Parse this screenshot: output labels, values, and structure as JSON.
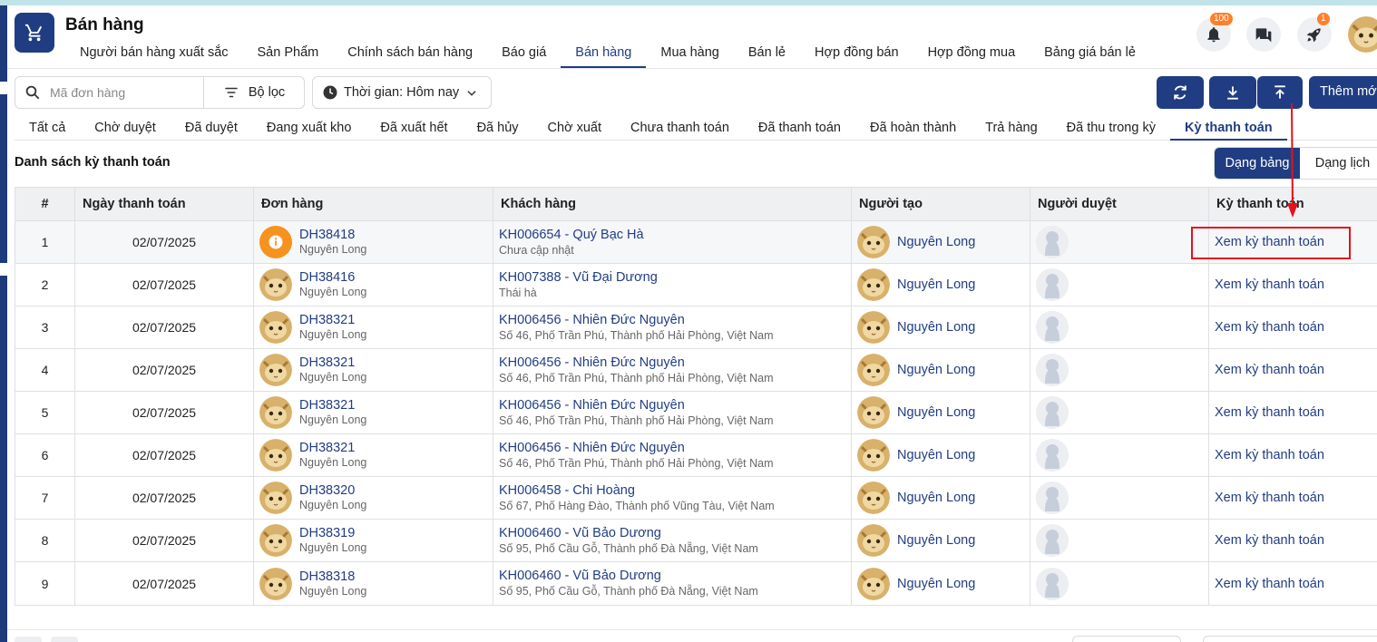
{
  "app": {
    "title": "Bán hàng"
  },
  "topnav": [
    {
      "label": "Người bán hàng xuất sắc",
      "active": false
    },
    {
      "label": "Sản Phẩm",
      "active": false
    },
    {
      "label": "Chính sách bán hàng",
      "active": false
    },
    {
      "label": "Báo giá",
      "active": false
    },
    {
      "label": "Bán hàng",
      "active": true
    },
    {
      "label": "Mua hàng",
      "active": false
    },
    {
      "label": "Bán lẻ",
      "active": false
    },
    {
      "label": "Hợp đồng bán",
      "active": false
    },
    {
      "label": "Hợp đồng mua",
      "active": false
    },
    {
      "label": "Bảng giá bán lẻ",
      "active": false
    }
  ],
  "header": {
    "notify_count": "100",
    "rocket_count": "1"
  },
  "toolbar": {
    "search_placeholder": "Mã đơn hàng",
    "filter_label": "Bộ lọc",
    "time_label": "Thời gian: Hôm nay",
    "add_label": "Thêm mới"
  },
  "status_tabs": [
    {
      "label": "Tất cả",
      "active": false
    },
    {
      "label": "Chờ duyệt",
      "active": false
    },
    {
      "label": "Đã duyệt",
      "active": false
    },
    {
      "label": "Đang xuất kho",
      "active": false
    },
    {
      "label": "Đã xuất hết",
      "active": false
    },
    {
      "label": "Đã hủy",
      "active": false
    },
    {
      "label": "Chờ xuất",
      "active": false
    },
    {
      "label": "Chưa thanh toán",
      "active": false
    },
    {
      "label": "Đã thanh toán",
      "active": false
    },
    {
      "label": "Đã hoàn thành",
      "active": false
    },
    {
      "label": "Trả hàng",
      "active": false
    },
    {
      "label": "Đã thu trong kỳ",
      "active": false
    },
    {
      "label": "Kỳ thanh toán",
      "active": true
    }
  ],
  "list": {
    "title": "Danh sách kỳ thanh toán",
    "view_table": "Dạng bảng",
    "view_calendar": "Dạng lịch"
  },
  "table": {
    "columns": [
      "#",
      "Ngày thanh toán",
      "Đơn hàng",
      "Khách hàng",
      "Người tạo",
      "Người duyệt",
      "Kỳ thanh toán"
    ],
    "rows": [
      {
        "no": "1",
        "date": "02/07/2025",
        "order": "DH38418",
        "order_by": "Nguyên Long",
        "customer": "KH006654 - Quý Bạc Hà",
        "address": "Chưa cập nhật",
        "creator": "Nguyên Long",
        "action": "Xem kỳ thanh toán",
        "info_icon": true
      },
      {
        "no": "2",
        "date": "02/07/2025",
        "order": "DH38416",
        "order_by": "Nguyên Long",
        "customer": "KH007388 - Vũ Đại Dương",
        "address": "Thái hà",
        "creator": "Nguyên Long",
        "action": "Xem kỳ thanh toán",
        "info_icon": false
      },
      {
        "no": "3",
        "date": "02/07/2025",
        "order": "DH38321",
        "order_by": "Nguyên Long",
        "customer": "KH006456 - Nhiên Đức Nguyên",
        "address": "Số 46, Phố Trần Phú, Thành phố Hải Phòng, Việt Nam",
        "creator": "Nguyên Long",
        "action": "Xem kỳ thanh toán",
        "info_icon": false
      },
      {
        "no": "4",
        "date": "02/07/2025",
        "order": "DH38321",
        "order_by": "Nguyên Long",
        "customer": "KH006456 - Nhiên Đức Nguyên",
        "address": "Số 46, Phố Trần Phú, Thành phố Hải Phòng, Việt Nam",
        "creator": "Nguyên Long",
        "action": "Xem kỳ thanh toán",
        "info_icon": false
      },
      {
        "no": "5",
        "date": "02/07/2025",
        "order": "DH38321",
        "order_by": "Nguyên Long",
        "customer": "KH006456 - Nhiên Đức Nguyên",
        "address": "Số 46, Phố Trần Phú, Thành phố Hải Phòng, Việt Nam",
        "creator": "Nguyên Long",
        "action": "Xem kỳ thanh toán",
        "info_icon": false
      },
      {
        "no": "6",
        "date": "02/07/2025",
        "order": "DH38321",
        "order_by": "Nguyên Long",
        "customer": "KH006456 - Nhiên Đức Nguyên",
        "address": "Số 46, Phố Trần Phú, Thành phố Hải Phòng, Việt Nam",
        "creator": "Nguyên Long",
        "action": "Xem kỳ thanh toán",
        "info_icon": false
      },
      {
        "no": "7",
        "date": "02/07/2025",
        "order": "DH38320",
        "order_by": "Nguyên Long",
        "customer": "KH006458 - Chi Hoàng",
        "address": "Số 67, Phố Hàng Đào, Thành phố Vũng Tàu, Việt Nam",
        "creator": "Nguyên Long",
        "action": "Xem kỳ thanh toán",
        "info_icon": false
      },
      {
        "no": "8",
        "date": "02/07/2025",
        "order": "DH38319",
        "order_by": "Nguyên Long",
        "customer": "KH006460 - Vũ Bảo Dương",
        "address": "Số 95, Phố Cầu Gỗ, Thành phố Đà Nẵng, Việt Nam",
        "creator": "Nguyên Long",
        "action": "Xem kỳ thanh toán",
        "info_icon": false
      },
      {
        "no": "9",
        "date": "02/07/2025",
        "order": "DH38318",
        "order_by": "Nguyên Long",
        "customer": "KH006460 - Vũ Bảo Dương",
        "address": "Số 95, Phố Cầu Gỗ, Thành phố Đà Nẵng, Việt Nam",
        "creator": "Nguyên Long",
        "action": "Xem kỳ thanh toán",
        "info_icon": false
      }
    ]
  },
  "colors": {
    "primary": "#203d83",
    "accent": "#f6921e",
    "highlight": "#e4121a"
  }
}
